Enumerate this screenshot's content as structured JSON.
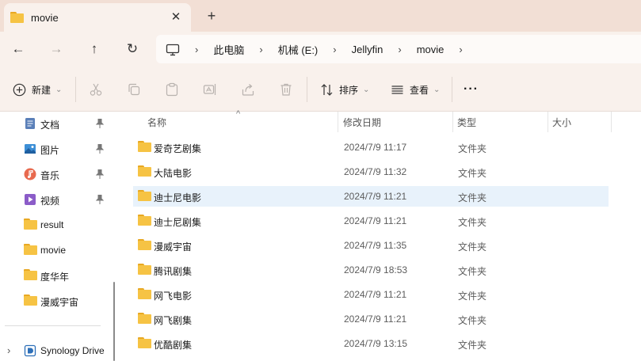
{
  "tab": {
    "title": "movie",
    "close_glyph": "✕",
    "add_glyph": "+"
  },
  "nav": {
    "back_glyph": "←",
    "forward_glyph": "→",
    "up_glyph": "↑",
    "refresh_glyph": "↻",
    "breadcrumbs": [
      "此电脑",
      "机械 (E:)",
      "Jellyfin",
      "movie"
    ],
    "separator": "›"
  },
  "commands": {
    "new_label": "新建",
    "sort_label": "排序",
    "view_label": "查看",
    "more_glyph": "···",
    "dropdown_glyph": "⌄"
  },
  "sidebar": {
    "items": [
      {
        "label": "文档",
        "icon": "documents-icon",
        "pinned": true
      },
      {
        "label": "图片",
        "icon": "pictures-icon",
        "pinned": true
      },
      {
        "label": "音乐",
        "icon": "music-icon",
        "pinned": true
      },
      {
        "label": "视频",
        "icon": "videos-icon",
        "pinned": true
      },
      {
        "label": "result",
        "icon": "folder-icon",
        "pinned": false
      },
      {
        "label": "movie",
        "icon": "folder-icon",
        "pinned": false
      },
      {
        "label": "度华年",
        "icon": "folder-icon",
        "pinned": false
      },
      {
        "label": "漫威宇宙",
        "icon": "folder-icon",
        "pinned": false
      }
    ],
    "drive": {
      "label": "Synology Drive",
      "expand_glyph": "›"
    }
  },
  "columns": {
    "name": "名称",
    "modified": "修改日期",
    "type": "类型",
    "size": "大小",
    "sort_glyph": "^"
  },
  "files": [
    {
      "name": "爱奇艺剧集",
      "modified": "2024/7/9 11:17",
      "type": "文件夹"
    },
    {
      "name": "大陆电影",
      "modified": "2024/7/9 11:32",
      "type": "文件夹"
    },
    {
      "name": "迪士尼电影",
      "modified": "2024/7/9 11:21",
      "type": "文件夹",
      "selected": true
    },
    {
      "name": "迪士尼剧集",
      "modified": "2024/7/9 11:21",
      "type": "文件夹"
    },
    {
      "name": "漫威宇宙",
      "modified": "2024/7/9 11:35",
      "type": "文件夹"
    },
    {
      "name": "腾讯剧集",
      "modified": "2024/7/9 18:53",
      "type": "文件夹"
    },
    {
      "name": "网飞电影",
      "modified": "2024/7/9 11:21",
      "type": "文件夹"
    },
    {
      "name": "网飞剧集",
      "modified": "2024/7/9 11:21",
      "type": "文件夹"
    },
    {
      "name": "优酷剧集",
      "modified": "2024/7/9 13:15",
      "type": "文件夹"
    }
  ],
  "colors": {
    "tabstrip": "#f2dfd5",
    "toolbar": "#f9f1ec",
    "selected_row": "#e8f2fb",
    "folder": "#f6c344"
  }
}
